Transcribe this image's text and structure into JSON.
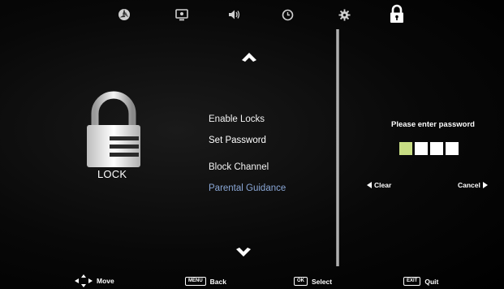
{
  "topbar": {
    "icons": [
      {
        "name": "picture-icon"
      },
      {
        "name": "screen-icon"
      },
      {
        "name": "sound-icon"
      },
      {
        "name": "clock-icon"
      },
      {
        "name": "gear-icon"
      },
      {
        "name": "lock-icon",
        "active": true
      }
    ]
  },
  "lock_panel": {
    "label": "LOCK"
  },
  "menu": {
    "items": [
      {
        "label": "Enable Locks"
      },
      {
        "label": "Set Password",
        "selected": true
      },
      {
        "label": "Block Channel"
      },
      {
        "label": "Parental Guidance",
        "dimmed": true
      }
    ]
  },
  "password": {
    "prompt": "Please enter password",
    "digits_total": 4,
    "active_index": 0,
    "clear_label": "Clear",
    "cancel_label": "Cancel"
  },
  "bottombar": {
    "move_label": "Move",
    "menu_key": "MENU",
    "back_label": "Back",
    "ok_key": "OK",
    "select_label": "Select",
    "exit_key": "EXIT",
    "quit_label": "Quit"
  },
  "colors": {
    "background": "#000000",
    "active_digit": "#c8dd84",
    "dimmed_text": "#8aa7d6"
  }
}
